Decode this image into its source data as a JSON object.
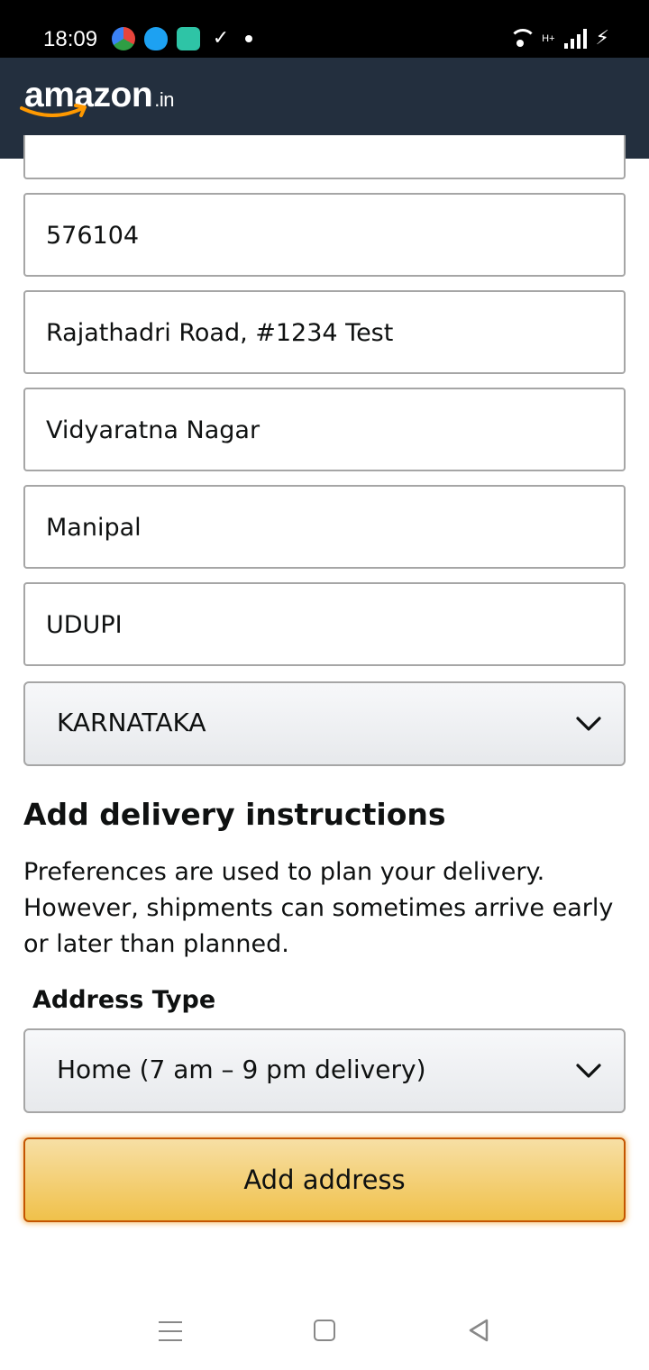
{
  "status_bar": {
    "time": "18:09",
    "icons": [
      "browser-icon",
      "shield-icon",
      "message-icon",
      "check-icon",
      "dot-icon"
    ],
    "right_icons": [
      "wifi-icon",
      "signal-icon",
      "charging-icon"
    ],
    "network_label": "H+"
  },
  "header": {
    "logo_text": "amazon",
    "logo_suffix": ".in"
  },
  "form": {
    "fields": [
      {
        "value": "576104"
      },
      {
        "value": "Rajathadri Road, #1234 Test"
      },
      {
        "value": "Vidyaratna Nagar"
      },
      {
        "value": "Manipal"
      },
      {
        "value": "UDUPI"
      }
    ],
    "state_select": {
      "value": "KARNATAKA"
    }
  },
  "delivery": {
    "title": "Add delivery instructions",
    "description": "Preferences are used to plan your delivery. However, shipments can sometimes arrive early or later than planned.",
    "address_type_label": "Address Type",
    "address_type_value": "Home (7 am – 9 pm delivery)"
  },
  "actions": {
    "add_address_label": "Add address"
  },
  "colors": {
    "header_bg": "#232f3e",
    "button_bg": "#f0c14b",
    "button_border": "#c45500",
    "smile": "#ff9900"
  }
}
